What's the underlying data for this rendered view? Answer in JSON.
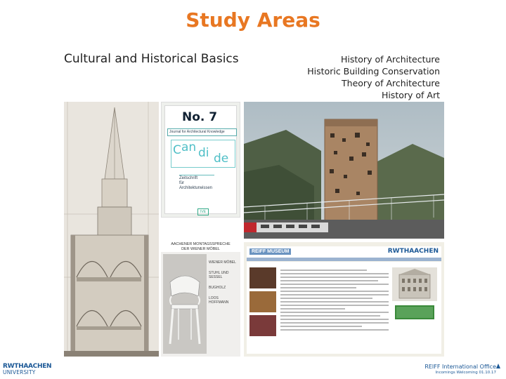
{
  "slide": {
    "title": "Study Areas",
    "subtitle": "Cultural and Historical Basics",
    "topics": [
      "History of Architecture",
      "Historic Building Conservation",
      "Theory of Architecture",
      "History of Art"
    ]
  },
  "images": {
    "journal": {
      "number": "No. 7",
      "subtitle": "Journal for Architectural Knowledge",
      "name_letters": [
        "C",
        "an",
        "di",
        "de"
      ],
      "small_lines": [
        "Zeitschrift",
        "für",
        "Architekturwissen"
      ],
      "badge": "IVE"
    },
    "exhibit": {
      "header_lines": [
        "AACHENER MONTAGSSPRECHE",
        "DER WIENER MÖBEL"
      ],
      "entries": [
        "WIENER MÖBEL",
        "STUHL UND SESSEL",
        "BUGHOLZ",
        "LOOS HOFFMANN"
      ]
    },
    "website": {
      "logo_left": "REIFF MUSEUM",
      "logo_right": "RWTHAACHEN"
    }
  },
  "footer": {
    "logo_line1": "RWTHAACHEN",
    "logo_line2": "UNIVERSITY",
    "office_prefix": "REIFF",
    "office_name": "International Office",
    "office_sub": "Incomings Welcoming 01.10.17"
  },
  "colors": {
    "title": "#e87722",
    "rwth_blue": "#1b5896"
  }
}
